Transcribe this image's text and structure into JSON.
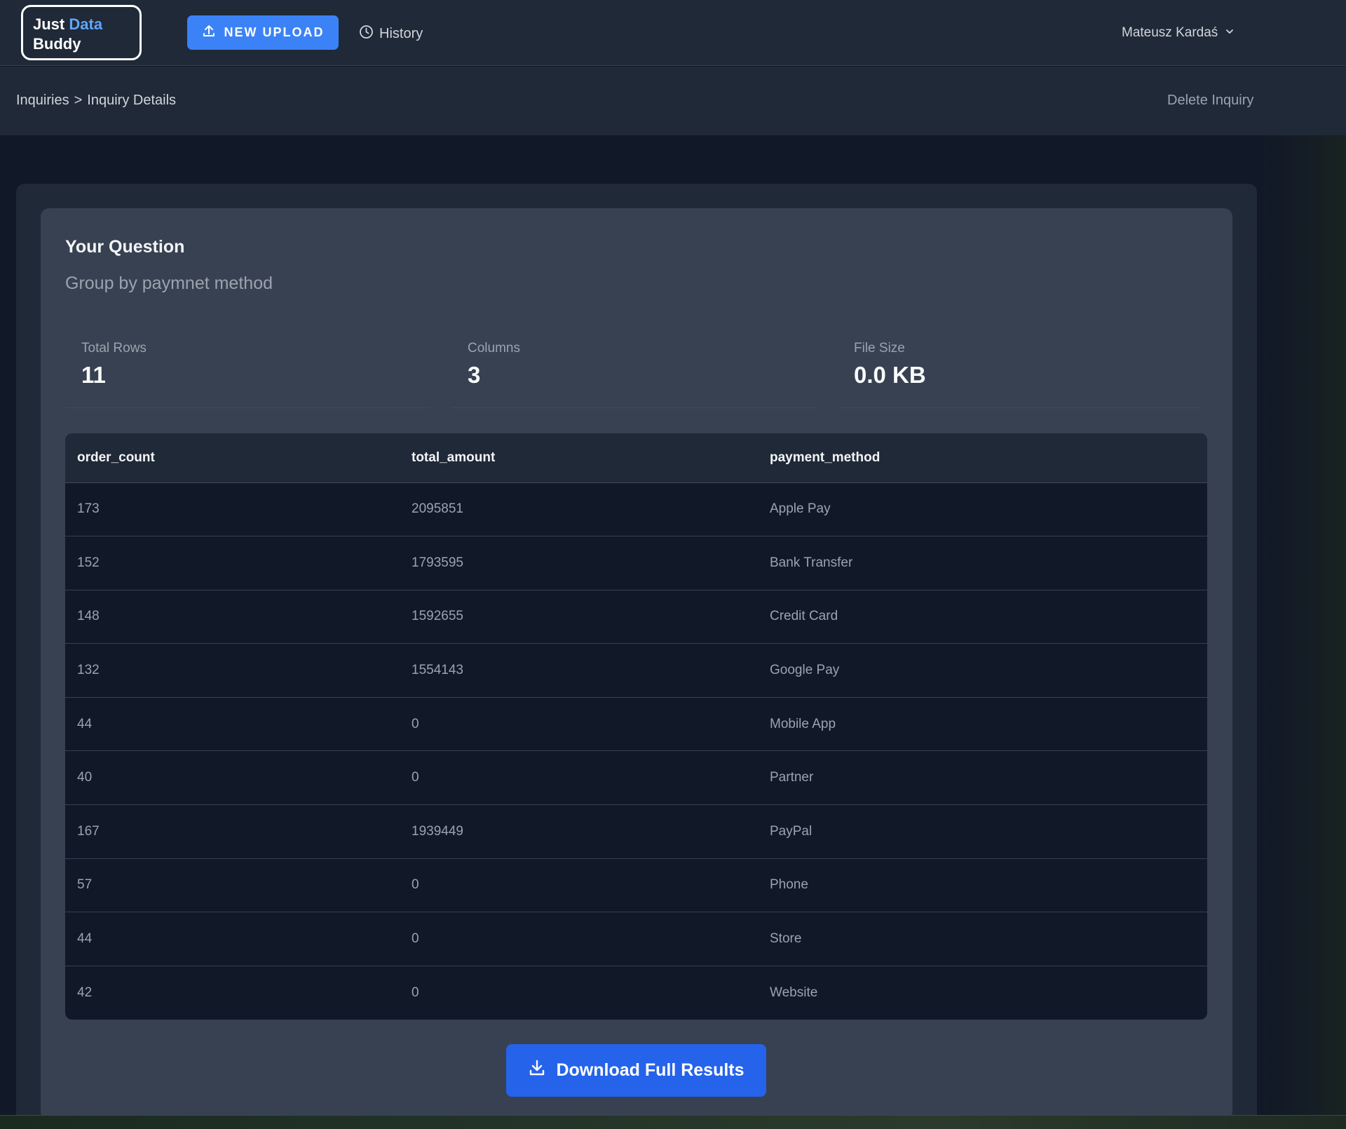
{
  "header": {
    "logo": {
      "line1_a": "Just",
      "line1_b": "Data",
      "line2": "Buddy"
    },
    "new_upload_label": "NEW UPLOAD",
    "history_label": "History",
    "user_name": "Mateusz Kardaś"
  },
  "subheader": {
    "breadcrumb": {
      "root": "Inquiries",
      "separator": ">",
      "current": "Inquiry Details"
    },
    "delete_label": "Delete Inquiry"
  },
  "question": {
    "heading": "Your Question",
    "text": "Group by paymnet method"
  },
  "stats": {
    "total_rows": {
      "label": "Total Rows",
      "value": "11"
    },
    "columns": {
      "label": "Columns",
      "value": "3"
    },
    "file_size": {
      "label": "File Size",
      "value": "0.0 KB"
    }
  },
  "table": {
    "headers": [
      "order_count",
      "total_amount",
      "payment_method"
    ],
    "rows": [
      [
        "173",
        "2095851",
        "Apple Pay"
      ],
      [
        "152",
        "1793595",
        "Bank Transfer"
      ],
      [
        "148",
        "1592655",
        "Credit Card"
      ],
      [
        "132",
        "1554143",
        "Google Pay"
      ],
      [
        "44",
        "0",
        "Mobile App"
      ],
      [
        "40",
        "0",
        "Partner"
      ],
      [
        "167",
        "1939449",
        "PayPal"
      ],
      [
        "57",
        "0",
        "Phone"
      ],
      [
        "44",
        "0",
        "Store"
      ],
      [
        "42",
        "0",
        "Website"
      ]
    ]
  },
  "download_label": "Download Full Results",
  "colors": {
    "accent": "#3b82f6",
    "logo_accent": "#60a5fa",
    "background": "#111827",
    "card": "#374151"
  },
  "icons": {
    "upload": "upload-icon",
    "history": "clock-icon",
    "user_menu": "chevron-down-icon",
    "download": "download-icon"
  }
}
